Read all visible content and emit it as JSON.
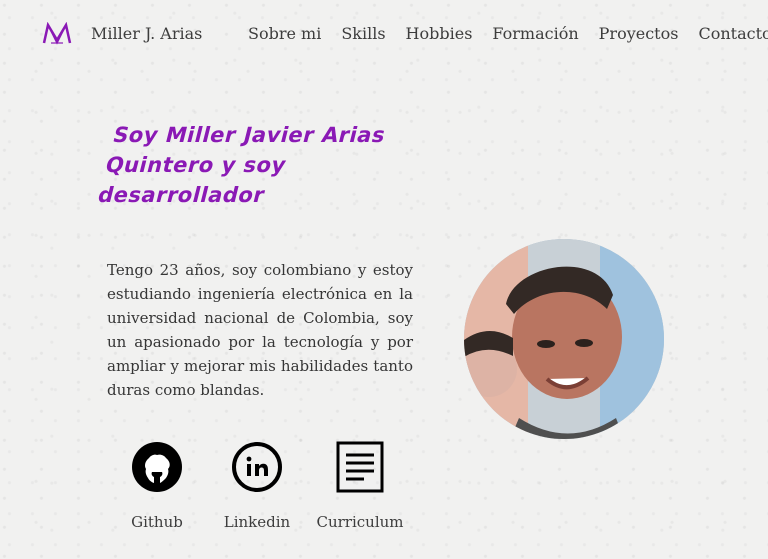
{
  "nav": {
    "logo_text": "M",
    "brand": "Miller J. Arias",
    "links": [
      "Sobre mi",
      "Skills",
      "Hobbies",
      "Formación",
      "Proyectos",
      "Contacto"
    ]
  },
  "hero": {
    "headline": "Soy Miller Javier Arias Quintero y soy desarrollador",
    "bio": "Tengo 23 años, soy colombiano y estoy estudiando ingeniería electrónica en la universidad nacional de Colombia, soy un apasionado por la tecnología y por ampliar y mejorar mis habilidades tanto duras como blandas."
  },
  "social": {
    "github": "Github",
    "linkedin": "Linkedin",
    "curriculum": "Curriculum"
  },
  "colors": {
    "accent": "#8a19b5",
    "text": "#333333",
    "background": "#f1f1f0"
  },
  "icons": [
    "logo-icon",
    "github-icon",
    "linkedin-icon",
    "curriculum-icon"
  ]
}
